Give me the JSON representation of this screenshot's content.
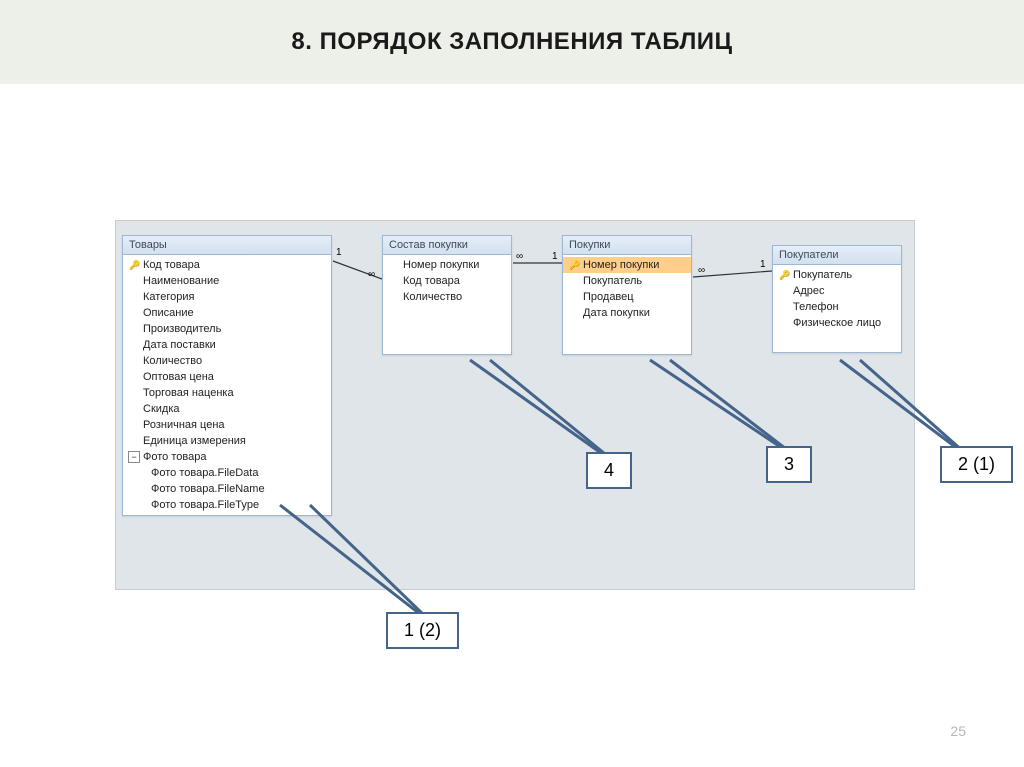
{
  "title": "8. ПОРЯДОК ЗАПОЛНЕНИЯ ТАБЛИЦ",
  "slide_number": "25",
  "tables": {
    "goods": {
      "title": "Товары",
      "fields": [
        "Код товара",
        "Наименование",
        "Категория",
        "Описание",
        "Производитель",
        "Дата поставки",
        "Количество",
        "Оптовая цена",
        "Торговая наценка",
        "Скидка",
        "Розничная цена",
        "Единица измерения",
        "Фото товара",
        "Фото товара.FileData",
        "Фото товара.FileName",
        "Фото товара.FileType"
      ]
    },
    "composition": {
      "title": "Состав покупки",
      "fields": [
        "Номер покупки",
        "Код товара",
        "Количество"
      ]
    },
    "purchases": {
      "title": "Покупки",
      "fields": [
        "Номер покупки",
        "Покупатель",
        "Продавец",
        "Дата покупки"
      ]
    },
    "buyers": {
      "title": "Покупатели",
      "fields": [
        "Покупатель",
        "Адрес",
        "Телефон",
        "Физическое лицо"
      ]
    }
  },
  "relations": {
    "one": "1",
    "inf": "∞"
  },
  "callouts": {
    "c1": "1 (2)",
    "c2": "2 (1)",
    "c3": "3",
    "c4": "4"
  }
}
